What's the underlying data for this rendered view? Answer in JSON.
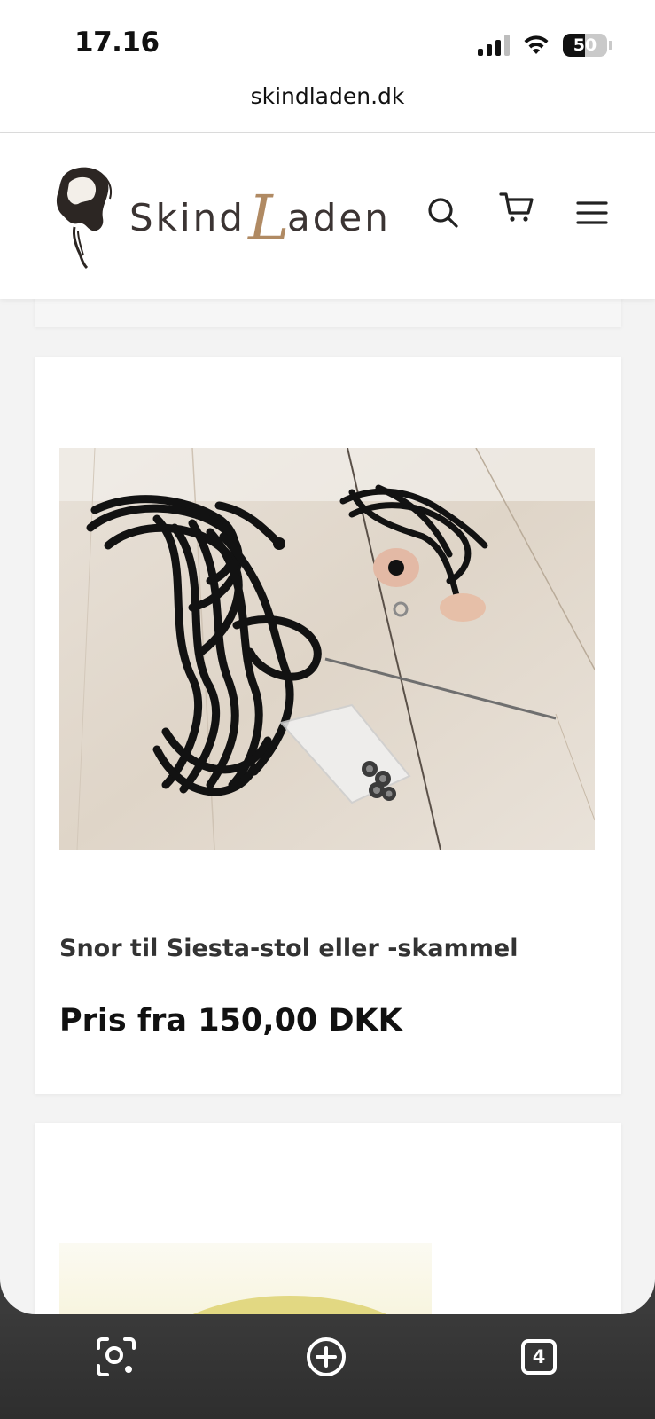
{
  "status_bar": {
    "time": "17.16",
    "battery_percent": "50",
    "signal_bars_active": 3,
    "signal_bars_total": 4
  },
  "browser": {
    "url": "skindladen.dk",
    "tab_count": "4"
  },
  "header": {
    "logo_text": "SkindLaden",
    "icons": [
      "search-icon",
      "cart-icon",
      "menu-icon"
    ]
  },
  "product": {
    "title": "Snor til Siesta-stol eller -skammel",
    "price": "Pris fra 150,00 DKK"
  },
  "toolbar": {
    "icons": [
      "visual-search-icon",
      "new-tab-icon",
      "tabs-icon"
    ]
  },
  "colors": {
    "logo_accent": "#b08a63",
    "page_background": "#f3f3f3",
    "toolbar_background": "#333333"
  }
}
